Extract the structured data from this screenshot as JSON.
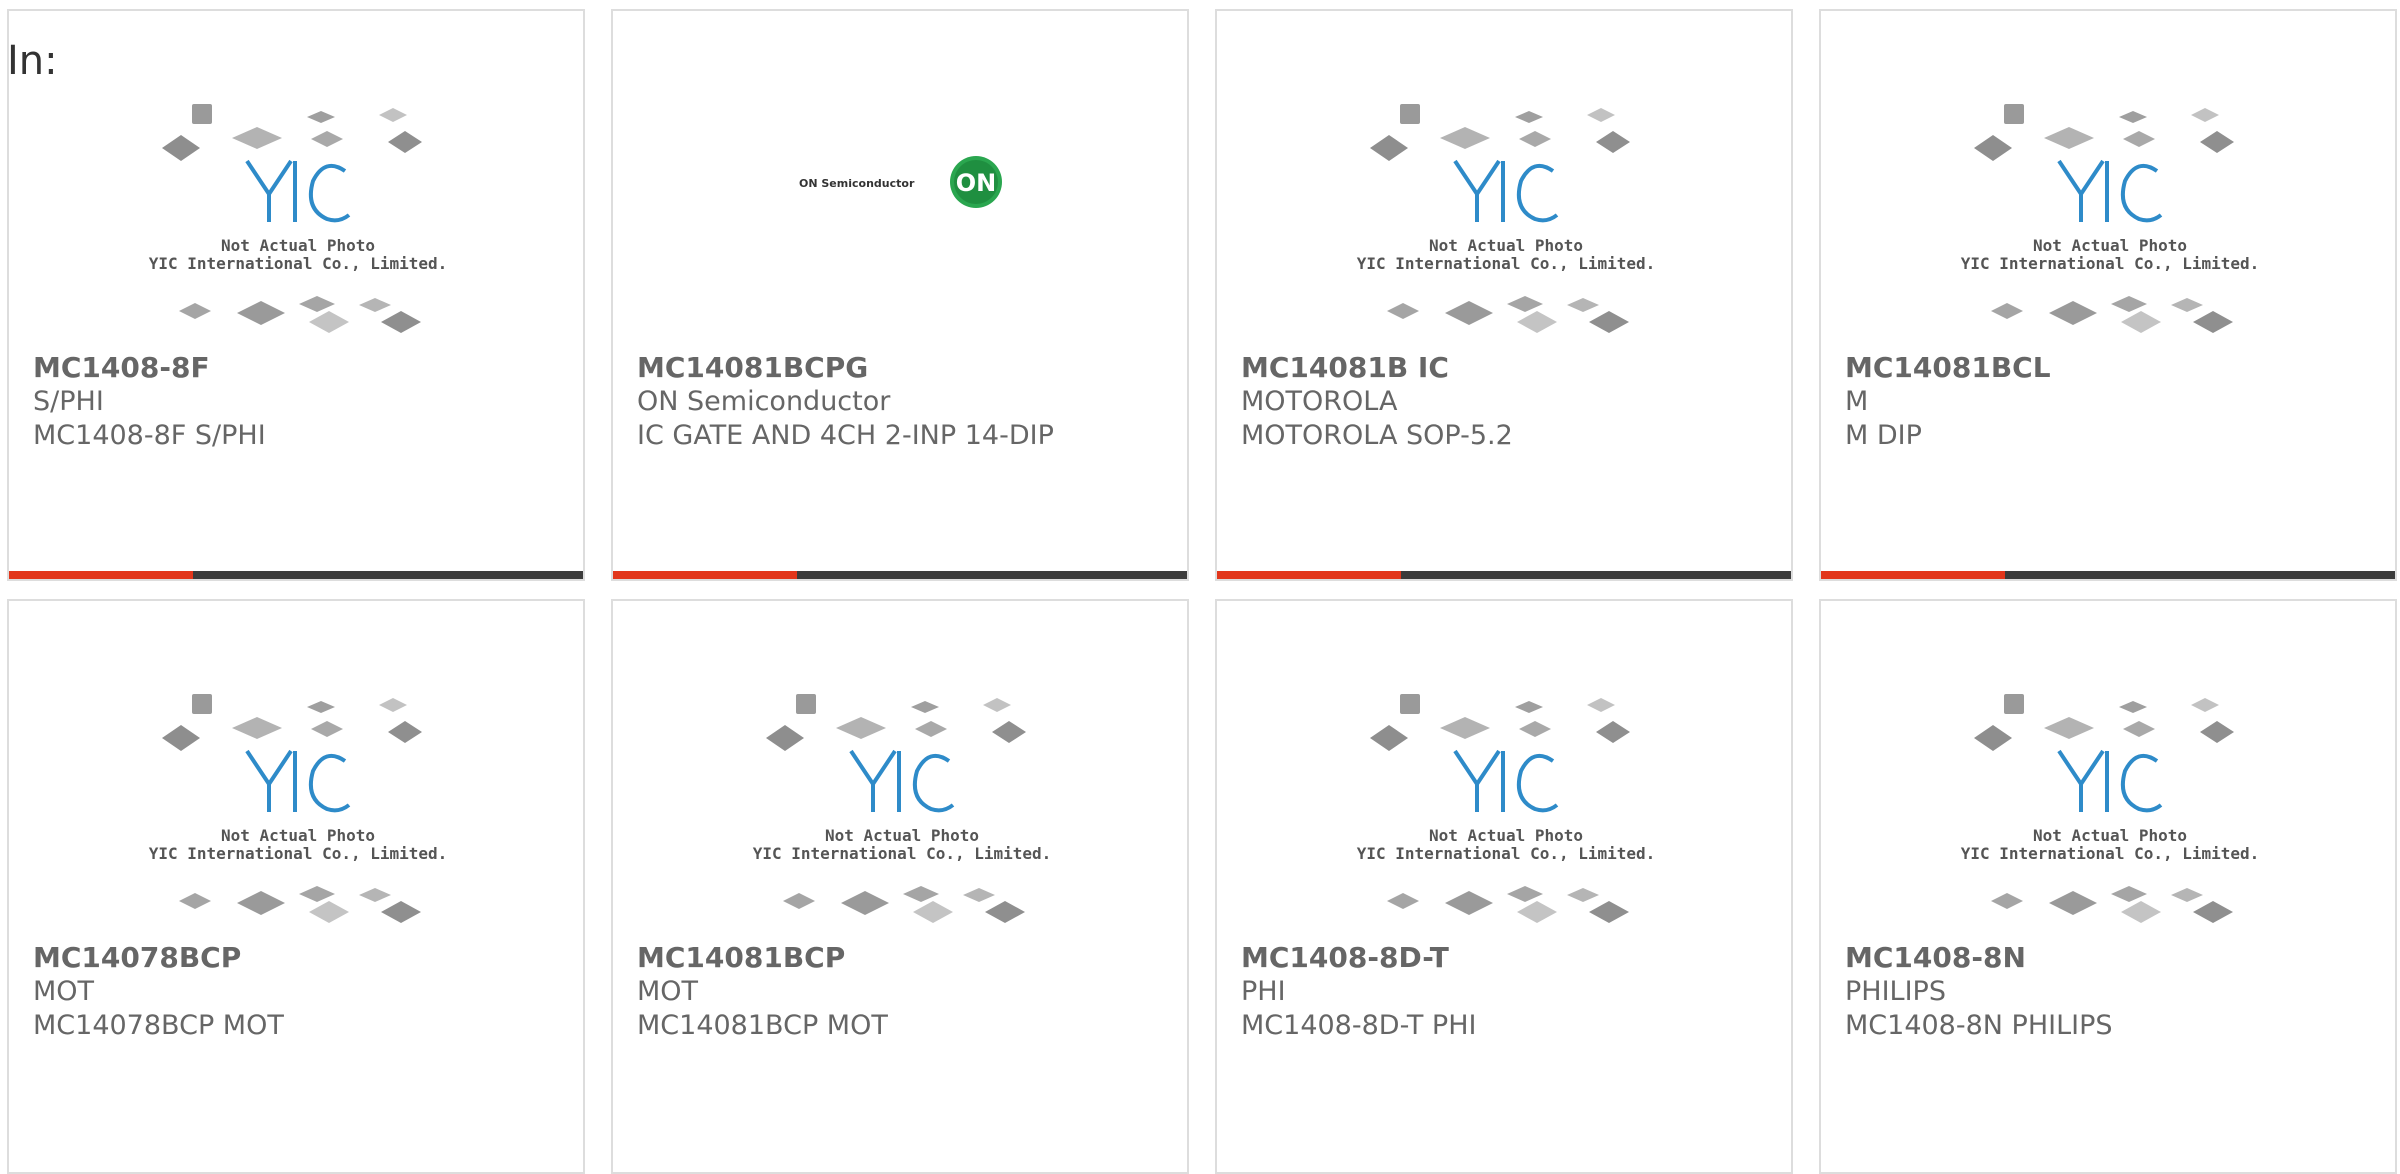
{
  "filter_label": "In:",
  "products": [
    {
      "part": "MC1408-8F",
      "manufacturer": "S/PHI",
      "description": "MC1408-8F S/PHI",
      "image": "yic-placeholder"
    },
    {
      "part": "MC14081BCPG",
      "manufacturer": "ON Semiconductor",
      "description": "IC GATE AND 4CH 2-INP 14-DIP",
      "image": "on-semiconductor-logo"
    },
    {
      "part": "MC14081B IC",
      "manufacturer": "MOTOROLA",
      "description": "MOTOROLA SOP-5.2",
      "image": "yic-placeholder"
    },
    {
      "part": "MC14081BCL",
      "manufacturer": "M",
      "description": "M DIP",
      "image": "yic-placeholder"
    },
    {
      "part": "MC14078BCP",
      "manufacturer": "MOT",
      "description": "MC14078BCP MOT",
      "image": "yic-placeholder"
    },
    {
      "part": "MC14081BCP",
      "manufacturer": "MOT",
      "description": "MC14081BCP MOT",
      "image": "yic-placeholder"
    },
    {
      "part": "MC1408-8D-T",
      "manufacturer": "PHI",
      "description": "MC1408-8D-T PHI",
      "image": "yic-placeholder"
    },
    {
      "part": "MC1408-8N",
      "manufacturer": "PHILIPS",
      "description": "MC1408-8N PHILIPS",
      "image": "yic-placeholder"
    }
  ],
  "placeholder_caption": {
    "line1": "Not Actual Photo",
    "line2": "YIC International Co., Limited."
  },
  "on_logo": {
    "wordmark": "ON Semiconductor",
    "badge": "ON"
  },
  "colors": {
    "accent": "#e2361b",
    "bar": "#3b3b3b",
    "yic_blue": "#2e8bc9"
  }
}
